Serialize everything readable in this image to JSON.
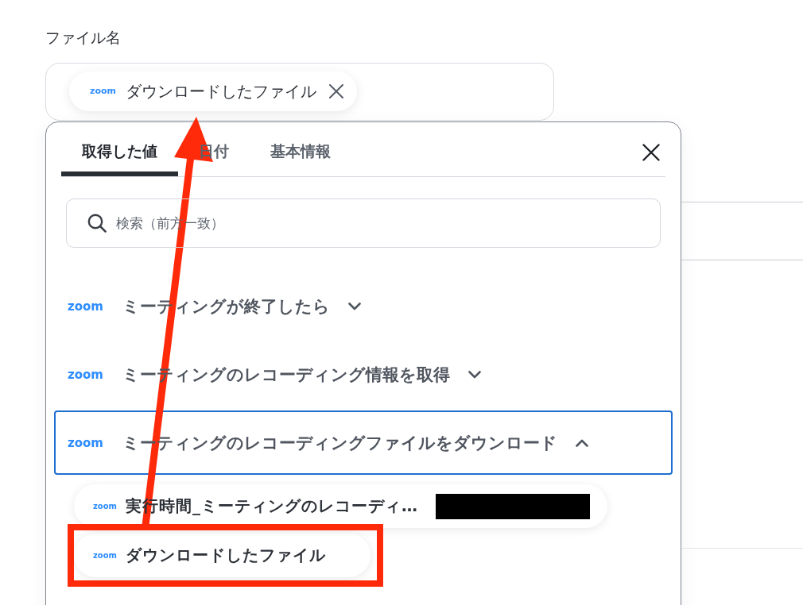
{
  "field": {
    "label": "ファイル名",
    "chip": {
      "logo": "zoom",
      "text": "ダウンロードしたファイル"
    }
  },
  "picker": {
    "tabs": [
      {
        "label": "取得した値",
        "selected": true
      },
      {
        "label": "日付",
        "selected": false
      },
      {
        "label": "基本情報",
        "selected": false
      }
    ],
    "search": {
      "placeholder": "検索（前方一致）"
    },
    "groups": [
      {
        "logo": "zoom",
        "title": "ミーティングが終了したら",
        "expanded": false
      },
      {
        "logo": "zoom",
        "title": "ミーティングのレコーディング情報を取得",
        "expanded": false
      },
      {
        "logo": "zoom",
        "title": "ミーティングのレコーディングファイルをダウンロード",
        "expanded": true,
        "children": [
          {
            "logo": "zoom",
            "label": "実行時間_ミーティングのレコーディ…",
            "redacted": true,
            "highlighted": false
          },
          {
            "logo": "zoom",
            "label": "ダウンロードしたファイル",
            "redacted": false,
            "highlighted": true
          }
        ]
      }
    ]
  }
}
